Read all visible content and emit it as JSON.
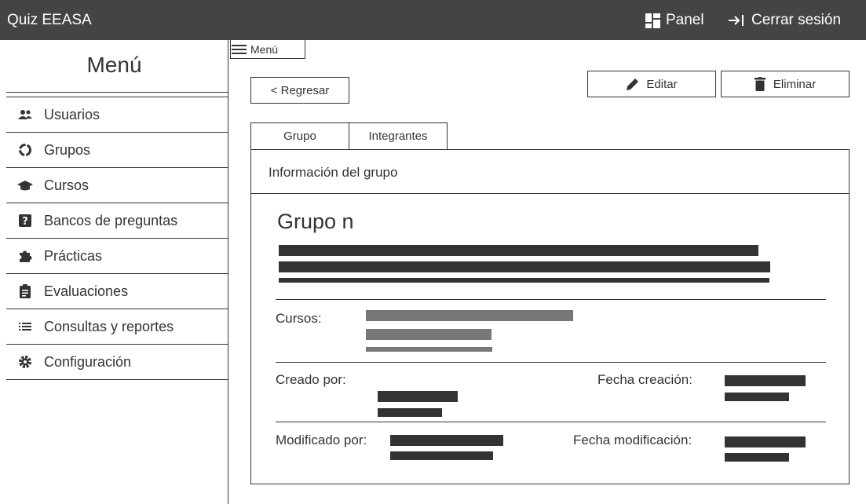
{
  "header": {
    "app_title": "Quiz EEASA",
    "panel_label": "Panel",
    "logout_label": "Cerrar sesión"
  },
  "sidebar": {
    "title": "Menú",
    "items": [
      {
        "label": "Usuarios",
        "icon": "users-icon"
      },
      {
        "label": "Grupos",
        "icon": "groups-icon"
      },
      {
        "label": "Cursos",
        "icon": "graduation-cap-icon"
      },
      {
        "label": "Bancos de preguntas",
        "icon": "question-square-icon"
      },
      {
        "label": "Prácticas",
        "icon": "puzzle-icon"
      },
      {
        "label": "Evaluaciones",
        "icon": "clipboard-icon"
      },
      {
        "label": "Consultas y reportes",
        "icon": "list-icon"
      },
      {
        "label": "Configuración",
        "icon": "gear-icon"
      }
    ]
  },
  "menu_toggle": {
    "label": "Menú"
  },
  "actions": {
    "back_label": "< Regresar",
    "edit_label": "Editar",
    "delete_label": "Eliminar"
  },
  "tabs": [
    {
      "label": "Grupo",
      "active": true
    },
    {
      "label": "Integrantes",
      "active": false
    }
  ],
  "card": {
    "header": "Información del grupo",
    "group_name": "Grupo n",
    "courses_label": "Cursos:",
    "created_by_label": "Creado por:",
    "created_date_label": "Fecha creación:",
    "modified_by_label": "Modificado por:",
    "modified_date_label": "Fecha modificación:"
  },
  "colors": {
    "topbar": "#444444",
    "text": "#333333",
    "placeholder_dark": "#333333",
    "placeholder_gray": "#777777"
  }
}
